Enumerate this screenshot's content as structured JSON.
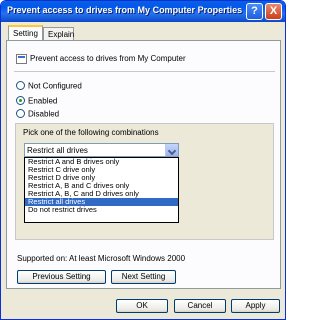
{
  "window": {
    "title": "Prevent access to drives from My Computer Properties",
    "help_symbol": "?",
    "close_symbol": "X"
  },
  "tabs": [
    {
      "label": "Setting",
      "active": true
    },
    {
      "label": "Explain",
      "active": false
    }
  ],
  "policy": {
    "name": "Prevent access to drives from My Computer",
    "icon": "policy-icon"
  },
  "state_options": [
    {
      "label": "Not Configured",
      "checked": false
    },
    {
      "label": "Enabled",
      "checked": true
    },
    {
      "label": "Disabled",
      "checked": false
    }
  ],
  "combinations": {
    "label": "Pick one of the following combinations",
    "selected_value": "Restrict all drives",
    "options": [
      "Restrict A and B drives only",
      "Restrict C drive only",
      "Restrict D drive only",
      "Restrict A, B and C drives only",
      "Restrict A, B, C and D drives only",
      "Restrict all drives",
      "Do not restrict drives"
    ],
    "highlighted_option": "Restrict all drives"
  },
  "supported": {
    "label": "Supported on:",
    "value": "At least Microsoft Windows 2000"
  },
  "nav_buttons": {
    "previous": "Previous Setting",
    "next": "Next Setting"
  },
  "dialog_buttons": {
    "ok": "OK",
    "cancel": "Cancel",
    "apply": "Apply"
  },
  "colors": {
    "titlebar": "#0058ee",
    "selection": "#316ac5",
    "dialog_face": "#ece9d8"
  }
}
